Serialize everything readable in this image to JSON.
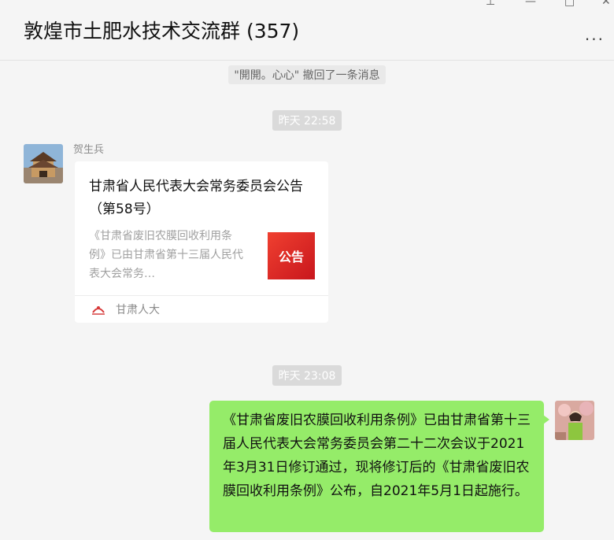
{
  "header": {
    "title": "敦煌市土肥水技术交流群 (357)",
    "more_icon": "more-dots-icon",
    "window_controls": [
      "minimize-icon",
      "maximize-icon",
      "close-icon"
    ]
  },
  "messages": {
    "recall_notice": "\"開開。心心\" 撤回了一条消息",
    "time1": "昨天 22:58",
    "time2": "昨天 23:08",
    "card": {
      "sender": "贺生兵",
      "title": "甘肃省人民代表大会常务委员会公告（第58号）",
      "description": "《甘肃省废旧农膜回收利用条例》已由甘肃省第十三届人民代表大会常务…",
      "thumb_text": "公告",
      "source": "甘肃人大"
    },
    "outgoing": {
      "text": "《甘肃省废旧农膜回收利用条例》已由甘肃省第十三届人民代表大会常务委员会第二十二次会议于2021年3月31日修订通过，现将修订后的《甘肃省废旧农膜回收利用条例》公布，自2021年5月1日起施行。"
    }
  },
  "colors": {
    "background": "#f5f5f5",
    "outgoing_bubble": "#95ec69",
    "time_badge": "#dadada",
    "thumb_red": "#c8161d"
  }
}
